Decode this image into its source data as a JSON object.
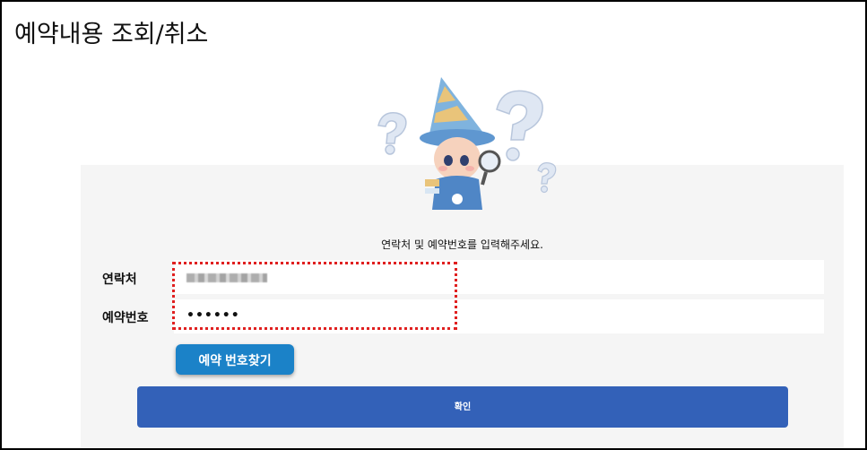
{
  "page": {
    "title": "예약내용 조회/취소"
  },
  "form": {
    "instruction": "연락처 및 예약번호를 입력해주세요.",
    "phone_label": "연락처",
    "reservation_label": "예약번호",
    "reservation_value": "••••••",
    "find_button": "예약 번호찾기",
    "confirm_button": "확인"
  },
  "colors": {
    "find_button": "#1b82c8",
    "confirm_button": "#3361b8",
    "highlight": "#e02020",
    "panel": "#f5f5f5"
  },
  "icons": {
    "mascot": "wizard-mascot-with-magnifier-and-question-marks"
  }
}
